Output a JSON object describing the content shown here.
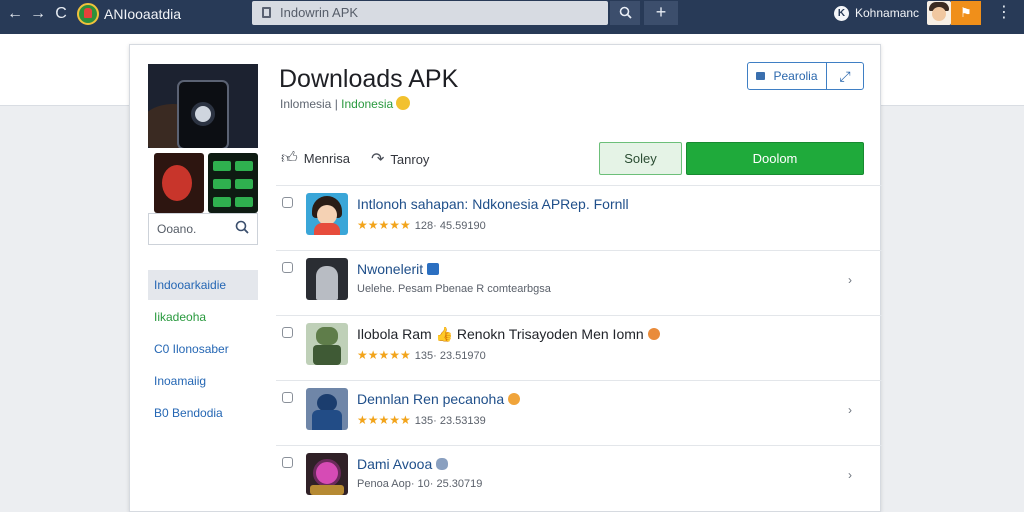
{
  "browser": {
    "brand_name": "ANIooaatdia",
    "url": "Indowrin APK",
    "user_name": "Kohnamanc",
    "user_badge": "K",
    "nav_back": "←",
    "nav_forward": "→",
    "nav_reload": "C",
    "search_icon": "search-icon",
    "add_icon": "plus-icon",
    "menu_icon": "kebab-icon"
  },
  "sidebar": {
    "search_label": "Ooano.",
    "items": [
      {
        "label": "Indooarkaidie"
      },
      {
        "label": "Iikadeoha"
      },
      {
        "label": "C0 Ilonosaber"
      },
      {
        "label": "Inoamaiig"
      },
      {
        "label": "B0 Bendodia"
      }
    ]
  },
  "header": {
    "title": "Downloads APK",
    "subtitle_plain": "Inlomesia | ",
    "subtitle_highlight": "Indonesia",
    "group_button_label": "Pearolia",
    "group_button_alt": "⤢",
    "like_label": "Menrisa",
    "share_label": "Tanroy",
    "secondary_button": "Soley",
    "primary_button": "Doolom"
  },
  "list": {
    "items": [
      {
        "title": "Intlonoh sahapan: Ndkonesia APRep. Fornll",
        "meta": "128· 45.59190",
        "stars": "★★★★★"
      },
      {
        "title": "Nwonelerit",
        "meta": "Uelehe. Pesam Pbenae R comtearbgsa",
        "stars": ""
      },
      {
        "title": "Ilobola Ram 👍  Renokn Trisayoden Men Iomn",
        "meta": "135· 23.51970",
        "stars": "★★★★★"
      },
      {
        "title": "Dennlan Ren pecanoha",
        "meta": "135· 23.53139",
        "stars": "★★★★★"
      },
      {
        "title": "Dami Avooa",
        "meta": "Penoa Aop· 10· 25.30719",
        "stars": ""
      }
    ]
  },
  "colors": {
    "topbar": "#283a57",
    "primary_green": "#1faa3b",
    "link_blue": "#1f4f8a",
    "accent_orange": "#f08f1a",
    "star_gold": "#f2a41b"
  }
}
